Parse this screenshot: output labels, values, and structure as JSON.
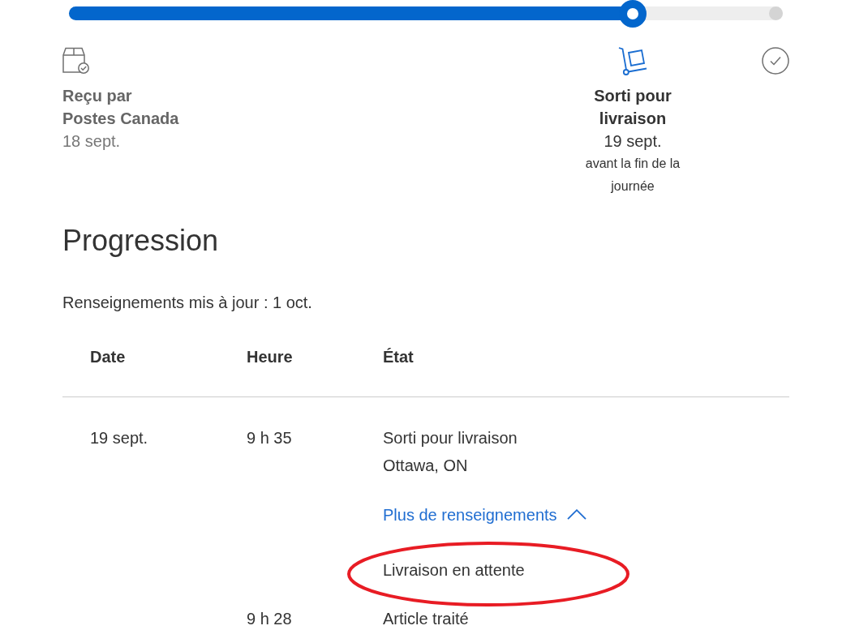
{
  "progress": {
    "level": 0.79
  },
  "milestones": [
    {
      "kind": "received",
      "current": false,
      "title": "Reçu par\nPostes Canada",
      "date": "18 sept."
    },
    {
      "kind": "dispatched",
      "current": true,
      "title": "Sorti pour\nlivraison",
      "date": "19 sept.",
      "note": "avant la fin de la journée"
    },
    {
      "kind": "delivered",
      "current": false
    }
  ],
  "heading": "Progression",
  "updated": "Renseignements mis à jour : 1 oct.",
  "table": {
    "columns": [
      "Date",
      "Heure",
      "État"
    ],
    "rows": [
      {
        "date": "19 sept.",
        "time": "9 h 35",
        "status": [
          "Sorti pour livraison",
          "Ottawa, ON"
        ],
        "more_link": {
          "label": "Plus de renseignements",
          "expanded": true
        },
        "details": [
          {
            "text": "Livraison en attente",
            "circled": true
          }
        ]
      },
      {
        "time": "9 h 28",
        "status": [
          "Article traité"
        ]
      }
    ]
  }
}
